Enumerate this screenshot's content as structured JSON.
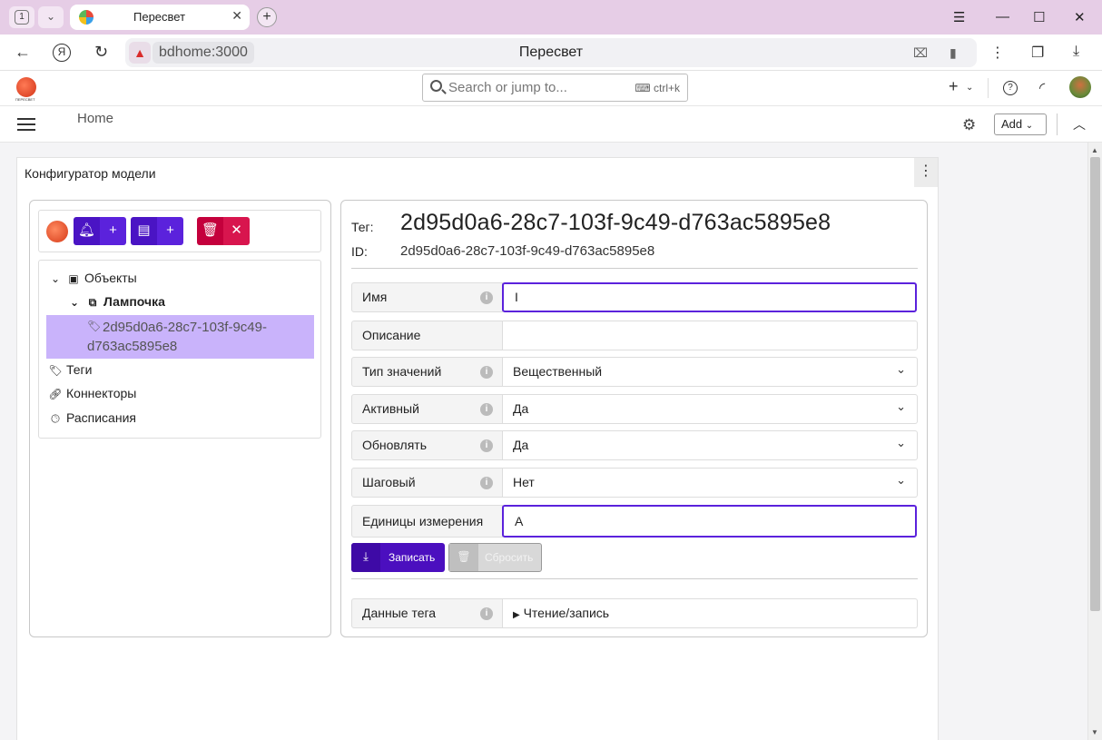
{
  "browser": {
    "tab_count": "1",
    "tab_title": "Пересвет",
    "url_host": "bdhome:3000",
    "page_title": "Пересвет"
  },
  "app": {
    "search_placeholder": "Search or jump to...",
    "search_shortcut": "ctrl+k",
    "breadcrumb_home": "Home",
    "add_label": "Add",
    "logo_caption": "ПЕРЕСВЕТ"
  },
  "panel": {
    "title": "Конфигуратор модели"
  },
  "tree": {
    "objects": "Объекты",
    "lamp": "Лампочка",
    "selected_tag": "2d95d0a6-28c7-103f-9c49-d763ac5895e8",
    "tags": "Теги",
    "connectors": "Коннекторы",
    "schedules": "Расписания"
  },
  "details": {
    "tag_label": "Тег:",
    "tag_value": "2d95d0a6-28c7-103f-9c49-d763ac5895e8",
    "id_label": "ID:",
    "id_value": "2d95d0a6-28c7-103f-9c49-d763ac5895e8",
    "fields": [
      {
        "label": "Имя",
        "value": "I"
      },
      {
        "label": "Описание",
        "value": ""
      },
      {
        "label": "Тип значений",
        "value": "Вещественный"
      },
      {
        "label": "Активный",
        "value": "Да"
      },
      {
        "label": "Обновлять",
        "value": "Да"
      },
      {
        "label": "Шаговый",
        "value": "Нет"
      },
      {
        "label": "Единицы измерения",
        "value": "А"
      }
    ],
    "save_label": "Записать",
    "reset_label": "Сбросить",
    "data_label": "Данные тега",
    "data_value": "Чтение/запись"
  },
  "colors": {
    "primary": "#4b0fbf",
    "danger": "#c4003c",
    "selection": "#c9b3fb",
    "chrome": "#e6cde6"
  }
}
